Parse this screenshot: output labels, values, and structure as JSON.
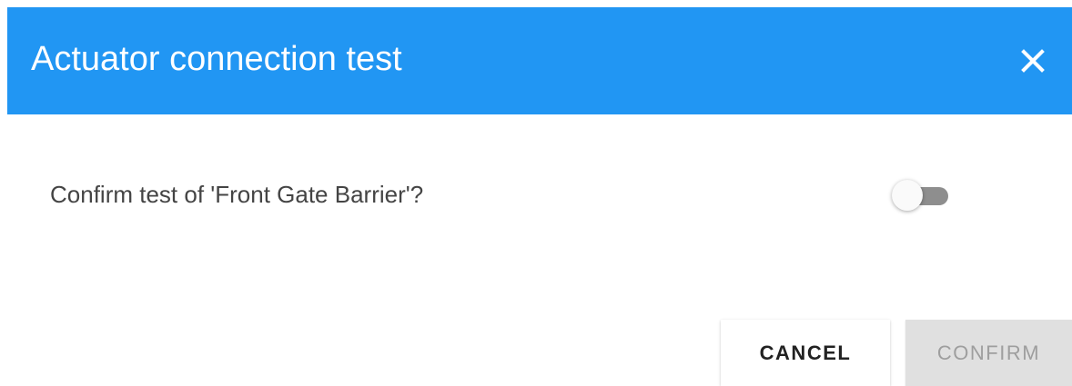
{
  "dialog": {
    "title": "Actuator connection test",
    "close_icon": "close-icon",
    "header_color": "#2196f3"
  },
  "body": {
    "question": "Confirm test of 'Front Gate Barrier'?",
    "toggle": {
      "checked": false
    }
  },
  "actions": {
    "cancel_label": "CANCEL",
    "confirm_label": "CONFIRM",
    "confirm_disabled": true
  }
}
